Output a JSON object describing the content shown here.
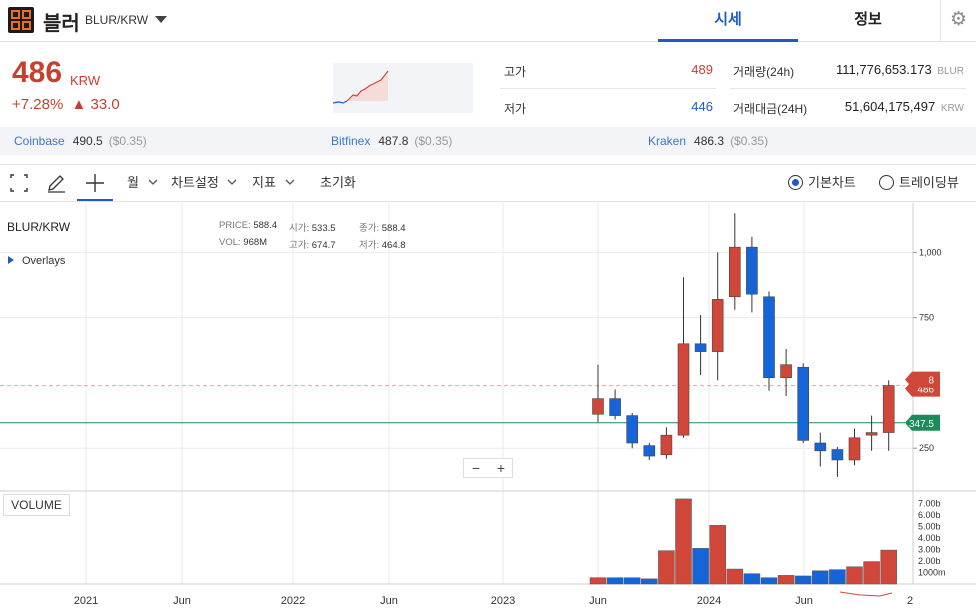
{
  "header": {
    "coin_name": "블러",
    "pair": "BLUR/KRW",
    "tabs": [
      "시세",
      "정보"
    ]
  },
  "ticker": {
    "price": "486",
    "currency": "KRW",
    "change_pct": "+7.28%",
    "change_arrow": "▲",
    "change_abs": "33.0"
  },
  "stats": {
    "high_label": "고가",
    "high_value": "489",
    "low_label": "저가",
    "low_value": "446",
    "volume_label": "거래량(24h)",
    "volume_value": "111,776,653.173",
    "volume_unit": "BLUR",
    "amount_label": "거래대금(24H)",
    "amount_value": "51,604,175,497",
    "amount_unit": "KRW"
  },
  "exchanges": [
    {
      "name": "Coinbase",
      "price": "490.5",
      "diff": "($0.35)"
    },
    {
      "name": "Bitfinex",
      "price": "487.8",
      "diff": "($0.35)"
    },
    {
      "name": "Kraken",
      "price": "486.3",
      "diff": "($0.35)"
    }
  ],
  "toolbar": {
    "period": "월",
    "chart_settings": "차트설정",
    "indicators": "지표",
    "reset": "초기화",
    "basic_chart": "기본차트",
    "trading_view": "트레이딩뷰"
  },
  "chart_info": {
    "pair": "BLUR/KRW",
    "overlays": "Overlays",
    "price_label": "PRICE:",
    "price_value": "588.4",
    "open_label": "시가:",
    "open_value": "533.5",
    "close_label": "종가:",
    "close_value": "588.4",
    "vol_label": "VOL:",
    "vol_value": "968M",
    "high_label": "고가:",
    "high_value": "674.7",
    "low_label": "저가:",
    "low_value": "464.8",
    "volume_button": "VOLUME",
    "price_tag_current": "486",
    "price_tag_partial": "8",
    "price_tag_line": "347.5"
  },
  "colors": {
    "up": "#d0473a",
    "down": "#1565d8",
    "accent": "#1e5bc6",
    "line_green": "#1e8a5a",
    "exchange_name": "#3a78c7"
  },
  "icons": [
    "fullscreen-icon",
    "pencil-icon",
    "crosshair-icon",
    "gear-icon",
    "chevron-down-icon"
  ],
  "chart_data": {
    "type": "candlestick",
    "x_ticks": [
      "2021",
      "Jun",
      "2022",
      "Jun",
      "2023",
      "Jun",
      "2024",
      "Jun",
      "2"
    ],
    "price_axis": [
      "1,000",
      "750",
      "250"
    ],
    "volume_axis": [
      "7.00b",
      "6.00b",
      "5.00b",
      "4.00b",
      "3.00b",
      "2.00b",
      "1000m"
    ],
    "price_ylim": [
      90,
      1170
    ],
    "volume_ylim": [
      0,
      8
    ],
    "candles": [
      {
        "o": 380,
        "c": 440,
        "h": 570,
        "l": 350
      },
      {
        "o": 440,
        "c": 375,
        "h": 475,
        "l": 360
      },
      {
        "o": 375,
        "c": 270,
        "h": 385,
        "l": 250
      },
      {
        "o": 260,
        "c": 220,
        "h": 270,
        "l": 205
      },
      {
        "o": 225,
        "c": 300,
        "h": 330,
        "l": 210
      },
      {
        "o": 300,
        "c": 650,
        "h": 905,
        "l": 290
      },
      {
        "o": 650,
        "c": 620,
        "h": 760,
        "l": 530
      },
      {
        "o": 620,
        "c": 820,
        "h": 1000,
        "l": 510
      },
      {
        "o": 830,
        "c": 1020,
        "h": 1150,
        "l": 780
      },
      {
        "o": 1020,
        "c": 840,
        "h": 1060,
        "l": 770
      },
      {
        "o": 830,
        "c": 520,
        "h": 850,
        "l": 470
      },
      {
        "o": 520,
        "c": 570,
        "h": 630,
        "l": 450
      },
      {
        "o": 560,
        "c": 280,
        "h": 575,
        "l": 270
      },
      {
        "o": 270,
        "c": 240,
        "h": 310,
        "l": 180
      },
      {
        "o": 245,
        "c": 205,
        "h": 255,
        "l": 140
      },
      {
        "o": 205,
        "c": 290,
        "h": 325,
        "l": 185
      },
      {
        "o": 300,
        "c": 310,
        "h": 375,
        "l": 240
      },
      {
        "o": 310,
        "c": 490,
        "h": 510,
        "l": 240
      }
    ],
    "volumes": [
      0.55,
      0.55,
      0.55,
      0.45,
      2.9,
      7.4,
      3.1,
      5.1,
      1.3,
      0.9,
      0.55,
      0.75,
      0.7,
      1.15,
      1.25,
      1.5,
      1.95,
      2.95
    ]
  }
}
